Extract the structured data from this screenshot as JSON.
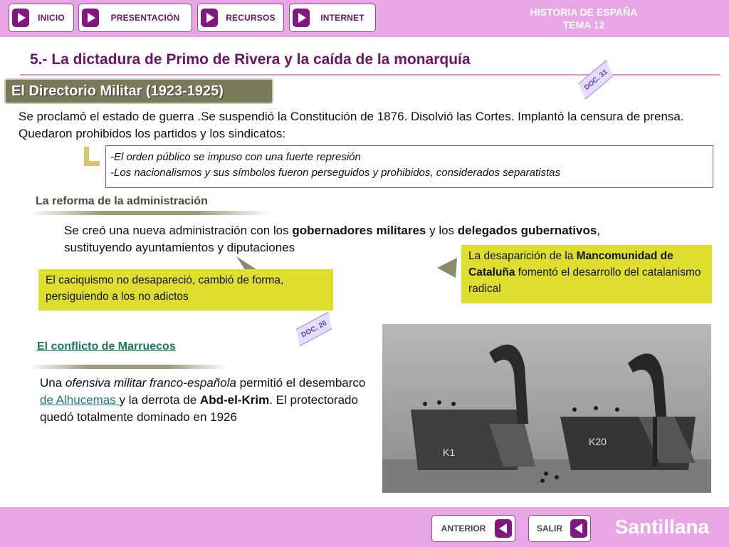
{
  "nav": {
    "inicio": "INICIO",
    "presentacion": "PRESENTACIÓN",
    "recursos": "RECURSOS",
    "internet": "INTERNET"
  },
  "brand": {
    "line1": "HISTORIA DE ESPAÑA",
    "line2": "TEMA 12"
  },
  "title": "5.- La dictadura de Primo de Rivera y la caída de la monarquía",
  "section": "El Directorio Militar (1923-1925)",
  "docs": {
    "doc31": "DOC. 31",
    "doc26": "DOC. 26"
  },
  "para1": "Se proclamó el estado de guerra .Se suspendió la Constitución de 1876. Disolvió las Cortes. Implantó la censura de prensa. Quedaron prohibidos los partidos y los sindicatos:",
  "bullets": [
    "-El orden público se impuso con una fuerte represión",
    "-Los nacionalismos y sus símbolos fueron perseguidos y prohibidos, considerados separatistas"
  ],
  "admin": {
    "heading": "La reforma de la administración",
    "p_a": "Se creó una nueva administración con los ",
    "p_b": "gobernadores militares",
    "p_c": " y los ",
    "p_d": "delegados gubernativos",
    "p_e": ", sustituyendo ayuntamientos y diputaciones"
  },
  "note_left": "El caciquismo no desapareció, cambió de forma, persiguiendo a los no adictos",
  "note_right": {
    "a": "La desaparición de la ",
    "b": "Mancomunidad de Cataluña",
    "c": " fomentó el desarrollo del catalanismo radical"
  },
  "marruecos": {
    "heading": "El conflicto de Marruecos",
    "a": "Una ",
    "b": "ofensiva militar franco-española",
    "c": " permitió el desembarco ",
    "link": "de Alhucemas ",
    "d": "y la derrota de ",
    "e": "Abd-el-Krim",
    "f": ". El protectorado quedó totalmente dominado en 1926"
  },
  "photo_text": {
    "k1": "K1",
    "k20": "K20"
  },
  "bottom": {
    "anterior": "ANTERIOR",
    "salir": "SALIR",
    "logo": "Santillana"
  },
  "colors": {
    "bar": "#e9a6e6",
    "accent": "#84177f",
    "note": "#dede2f"
  }
}
